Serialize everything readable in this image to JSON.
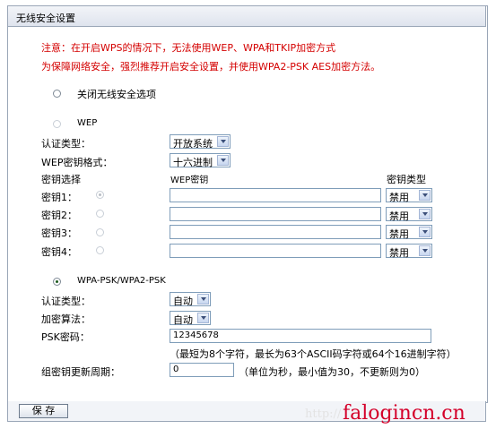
{
  "panel_title": "无线安全设置",
  "notice": {
    "line1": "注意：在开启WPS的情况下，无法使用WEP、WPA和TKIP加密方式",
    "line2": "为保障网络安全，强烈推荐开启安全设置，并使用WPA2-PSK AES加密方法。"
  },
  "off_option": {
    "label": "关闭无线安全选项",
    "checked": false
  },
  "wep": {
    "label": "WEP",
    "checked": false,
    "auth_label": "认证类型：",
    "auth_value": "开放系统",
    "format_label": "WEP密钥格式：",
    "format_value": "十六进制",
    "col_select": "密钥选择",
    "col_key": "WEP密钥",
    "col_type": "密钥类型",
    "keys": [
      {
        "label": "密钥1：",
        "value": "",
        "type": "禁用",
        "selected": true
      },
      {
        "label": "密钥2：",
        "value": "",
        "type": "禁用",
        "selected": false
      },
      {
        "label": "密钥3：",
        "value": "",
        "type": "禁用",
        "selected": false
      },
      {
        "label": "密钥4：",
        "value": "",
        "type": "禁用",
        "selected": false
      }
    ]
  },
  "wpa": {
    "label": "WPA-PSK/WPA2-PSK",
    "checked": true,
    "auth_label": "认证类型：",
    "auth_value": "自动",
    "enc_label": "加密算法：",
    "enc_value": "自动",
    "psk_label": "PSK密码：",
    "psk_value": "12345678",
    "psk_hint": "（最短为8个字符，最长为63个ASCII码字符或64个16进制字符）",
    "rekey_label": "组密钥更新周期：",
    "rekey_value": "0",
    "rekey_hint": "（单位为秒，最小值为30，不更新则为0）"
  },
  "save_label": "保 存",
  "watermark": {
    "faint": "http://",
    "main": "falogincn.cn"
  },
  "colors": {
    "notice": "#d40000",
    "watermark": "#d4002a"
  }
}
